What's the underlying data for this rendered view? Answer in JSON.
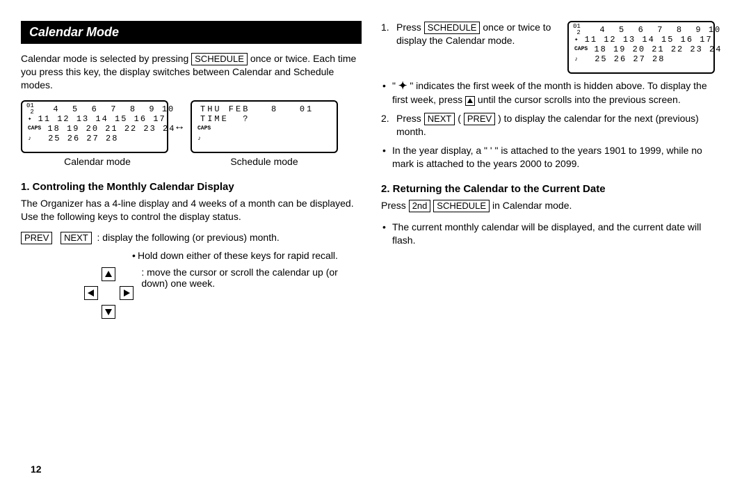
{
  "banner": "Calendar Mode",
  "left": {
    "p1a": "Calendar mode is selected by pressing ",
    "k_schedule": "SCHEDULE",
    "p1b": " once or twice. Each time you press this key, the display switches between Calendar and Schedule modes.",
    "lcd_cal": {
      "corner1": "01",
      "corner2": "2",
      "r1": "  4  5  6  7  8  9 10",
      "r2_sym": "✦",
      "r2": " 11 12 13 14 15 16 17",
      "r3_caps": "CAPS",
      "r3": " 18 19 20 21 22 23 24",
      "r4_sym": "♪",
      "r4": " 25 26 27 28"
    },
    "arrow_between": "↔",
    "lcd_sched": {
      "r1": "THU FEB   8   01",
      "r2": "TIME  ?",
      "r3_caps": "CAPS",
      "r4_sym": "♪"
    },
    "cap_a": "Calendar mode",
    "cap_b": "Schedule mode",
    "h_section1": "1. Controling the Monthly Calendar Display",
    "p2": "The Organizer has a 4-line display and 4 weeks of a month can be displayed. Use the following keys to control the display status.",
    "k_prev": "PREV",
    "k_next": "NEXT",
    "key_desc": ": display the following (or previous) month.",
    "hold_note": "Hold down either of these keys for rapid recall.",
    "move_desc": ": move the cursor or scroll the calendar up (or down) one week."
  },
  "right": {
    "step1_a": "Press ",
    "k_schedule": "SCHEDULE",
    "step1_b": " once or twice to display the Calendar mode.",
    "lcd": {
      "corner1": "01",
      "corner2": "2",
      "r1": "  4  5  6  7  8  9 10",
      "r2_sym": "✦",
      "r2": " 11 12 13 14 15 16 17",
      "r3_caps": "CAPS",
      "r3": " 18 19 20 21 22 23 24",
      "r4_sym": "♪",
      "r4": " 25 26 27 28"
    },
    "bul1_a": "\" ",
    "bul1_arrow": "✦",
    "bul1_b": " \" indicates the first week of the month is hidden above. To display the first week, press ",
    "bul1_c": " until the cursor scrolls into the previous screen.",
    "step2_a": "Press ",
    "k_next": "NEXT",
    "step2_paren_o": " ( ",
    "k_prev": "PREV",
    "step2_paren_c": " )  to display the calendar for the next (previous) month.",
    "bul2": "In the year display, a \"  '  \" is attached to the years 1901 to 1999, while no mark is attached to the years 2000 to 2099.",
    "h_section2": "2. Returning the Calendar to the Current Date",
    "p3_a": "Press ",
    "k_2nd": "2nd",
    "p3_b": " in Calendar mode.",
    "bul3": "The current monthly calendar will be displayed, and the current date will flash."
  },
  "page_number": "12"
}
